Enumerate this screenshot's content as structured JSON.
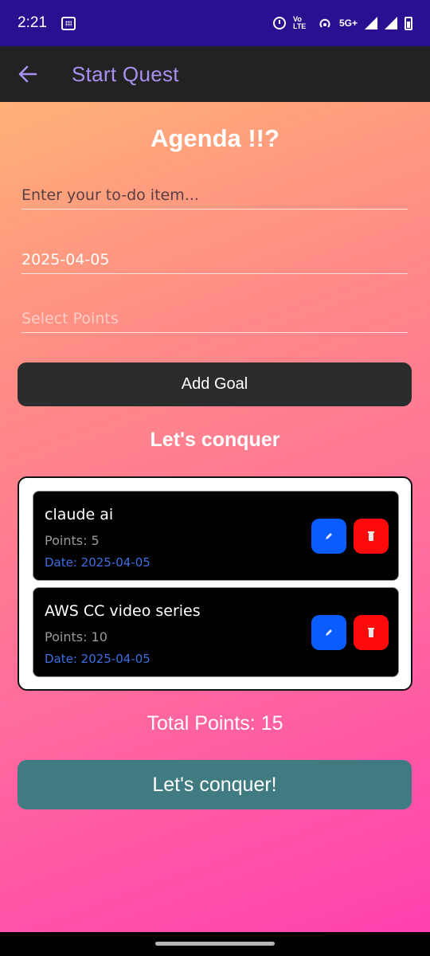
{
  "status_bar": {
    "time": "2:21",
    "network_label": "5G+",
    "volte_label": "Vo LTE"
  },
  "app_bar": {
    "title": "Start Quest",
    "back_icon": "arrow-left-icon"
  },
  "form": {
    "heading": "Agenda !!?",
    "todo_placeholder": "Enter your to-do item...",
    "date_value": "2025-04-05",
    "points_placeholder": "Select Points",
    "add_button": "Add Goal"
  },
  "list": {
    "heading": "Let's conquer",
    "items": [
      {
        "name": "claude ai",
        "points": "Points: 5",
        "date": "Date: 2025-04-05"
      },
      {
        "name": "AWS CC video series",
        "points": "Points: 10",
        "date": "Date: 2025-04-05"
      }
    ]
  },
  "summary": {
    "total": "Total Points: 15",
    "conquer_button": "Let's conquer!"
  },
  "colors": {
    "app_bar_title": "#a98ff0",
    "edit_button": "#0a5cff",
    "delete_button": "#ff0a0a",
    "date_text": "#3d6fe0",
    "conquer_button": "#3f7b80"
  }
}
